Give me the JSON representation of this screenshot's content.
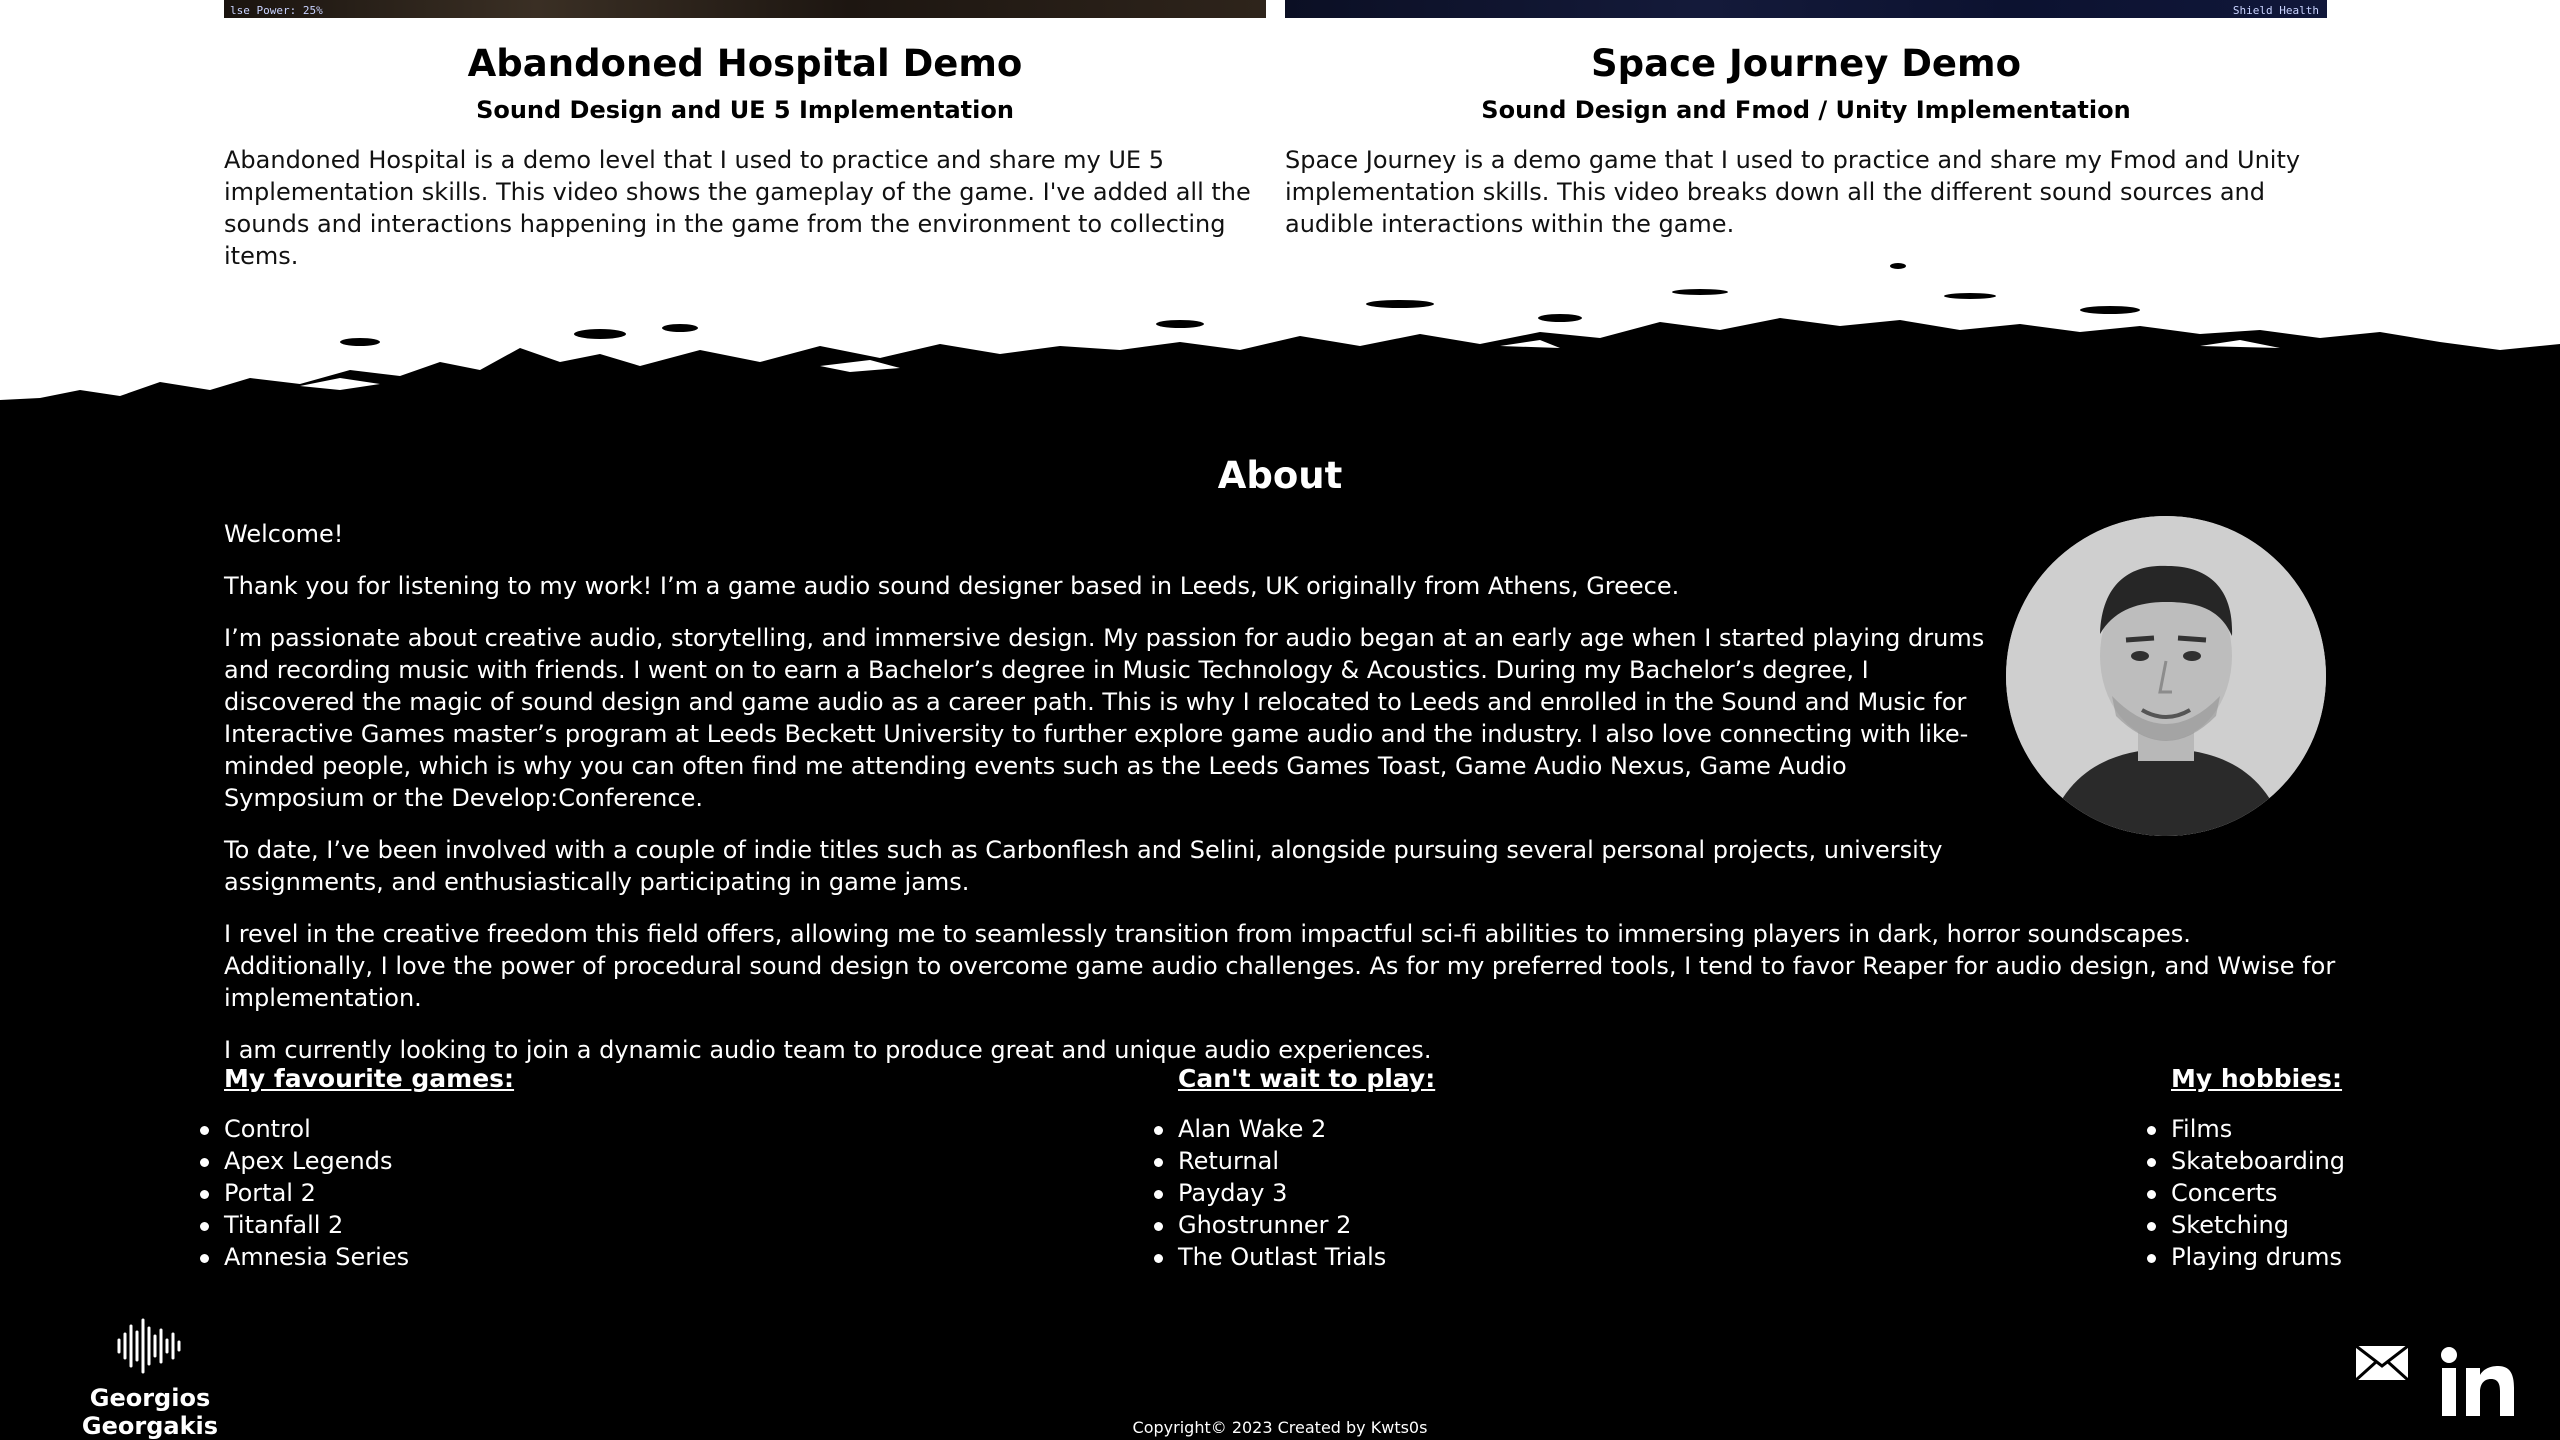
{
  "projects": [
    {
      "strip_text": "lse Power: 25%",
      "title": "Abandoned Hospital Demo",
      "subtitle": "Sound Design and UE 5 Implementation",
      "description": "Abandoned Hospital is a demo level that I used to practice and share my UE 5 implementation skills. This video shows the gameplay of the game. I've added all the sounds and interactions happening in the game from the environment to collecting items."
    },
    {
      "strip_text": "Shield Health",
      "title": "Space Journey Demo",
      "subtitle": "Sound Design and Fmod / Unity Implementation",
      "description": "Space Journey is a demo game that I used to practice and share my Fmod and Unity implementation skills. This video breaks down all the different sound sources and audible interactions within the game."
    }
  ],
  "about": {
    "title": "About",
    "paragraphs": [
      "Welcome!",
      "Thank you for listening to my work! I’m a game audio sound designer based in Leeds, UK originally from Athens, Greece.",
      "I’m passionate about creative audio, storytelling, and immersive design. My passion for audio began at an early age when I started playing drums and recording music with friends. I went on to earn a Bachelor’s degree in Music Technology & Acoustics. During my Bachelor’s degree, I discovered the magic of sound design and game audio as a career path. This is why I relocated to Leeds and enrolled in the Sound and Music for Interactive Games master’s program at Leeds Beckett University to further explore game audio and the industry. I also love connecting with like-minded people, which is why you can often find me attending events such as the Leeds Games Toast, Game Audio Nexus, Game Audio Symposium or the Develop:Conference.",
      "To date, I’ve been involved with a couple of indie titles such as Carbonflesh and Selini, alongside pursuing several personal projects, university assignments, and enthusiastically participating in game jams.",
      "I revel in the creative freedom this field offers, allowing me to seamlessly transition from impactful sci-fi abilities to immersing players in dark, horror soundscapes. Additionally, I love the power of procedural sound design to overcome game audio challenges. As for my preferred tools, I tend to favor Reaper for audio design, and Wwise for implementation.",
      "I am currently looking to join a dynamic audio team to produce great and unique audio experiences."
    ],
    "lists": [
      {
        "heading": "My favourite games:",
        "items": [
          "Control",
          "Apex Legends",
          "Portal 2",
          "Titanfall 2",
          "Amnesia Series"
        ]
      },
      {
        "heading": "Can't wait to play:",
        "items": [
          "Alan Wake 2",
          "Returnal",
          "Payday 3",
          "Ghostrunner 2",
          "The Outlast Trials"
        ]
      },
      {
        "heading": "My hobbies:",
        "items": [
          "Films",
          "Skateboarding",
          "Concerts",
          "Sketching",
          "Playing drums"
        ]
      }
    ]
  },
  "footer": {
    "brand_name": "Georgios Georgakis",
    "copyright": "Copyright© 2023 Created by Kwts0s",
    "icons": {
      "brand": "soundwave-icon",
      "mail": "mail-icon",
      "linkedin": "linkedin-icon"
    }
  },
  "colors": {
    "footer_bg": "#000000",
    "page_bg": "#ffffff",
    "text_light": "#ffffff"
  }
}
